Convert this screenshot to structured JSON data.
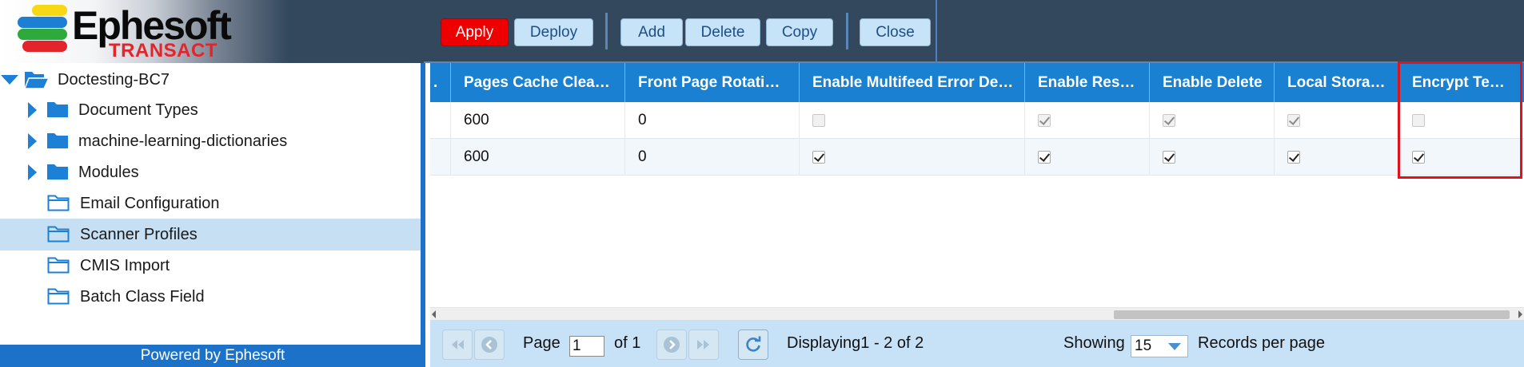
{
  "app": {
    "brand_name": "Ephesoft",
    "brand_sub": "TRANSACT",
    "colors": {
      "header_bg": "#33475d",
      "accent": "#1c72c8",
      "apply": "#ee0000",
      "highlight": "#e0121e"
    }
  },
  "toolbar": {
    "apply": "Apply",
    "deploy": "Deploy",
    "add": "Add",
    "delete": "Delete",
    "copy": "Copy",
    "close": "Close"
  },
  "sidebar": {
    "root": {
      "label": "Doctesting-BC7",
      "icon": "folder-open-icon",
      "expanded": true
    },
    "items": [
      {
        "label": "Document Types",
        "icon": "folder-filled-icon",
        "expandable": true
      },
      {
        "label": "machine-learning-dictionaries",
        "icon": "folder-filled-icon",
        "expandable": true
      },
      {
        "label": "Modules",
        "icon": "folder-filled-icon",
        "expandable": true
      },
      {
        "label": "Email Configuration",
        "icon": "folder-outline-icon",
        "expandable": false
      },
      {
        "label": "Scanner Profiles",
        "icon": "folder-outline-icon",
        "expandable": false,
        "selected": true
      },
      {
        "label": "CMIS Import",
        "icon": "folder-outline-icon",
        "expandable": false
      },
      {
        "label": "Batch Class Field",
        "icon": "folder-outline-icon",
        "expandable": false
      }
    ],
    "footer": "Powered by Ephesoft"
  },
  "grid": {
    "columns": [
      ".",
      "Pages Cache Clea…",
      "Front Page Rotati…",
      "Enable Multifeed Error De…",
      "Enable Res…",
      "Enable Delete",
      "Local Stora…",
      "Encrypt Te…"
    ],
    "rows": [
      {
        "pages_cache": "600",
        "front_page": "0",
        "multifeed": false,
        "res": true,
        "delete": true,
        "local": true,
        "encrypt": false,
        "disabled": true
      },
      {
        "pages_cache": "600",
        "front_page": "0",
        "multifeed": true,
        "res": true,
        "delete": true,
        "local": true,
        "encrypt": true,
        "disabled": false
      }
    ]
  },
  "pager": {
    "page_label": "Page",
    "page_value": "1",
    "of_label": "of 1",
    "displaying": "Displaying1 - 2 of 2",
    "showing_label": "Showing",
    "per_page_value": "15",
    "records_label": "Records per page"
  }
}
